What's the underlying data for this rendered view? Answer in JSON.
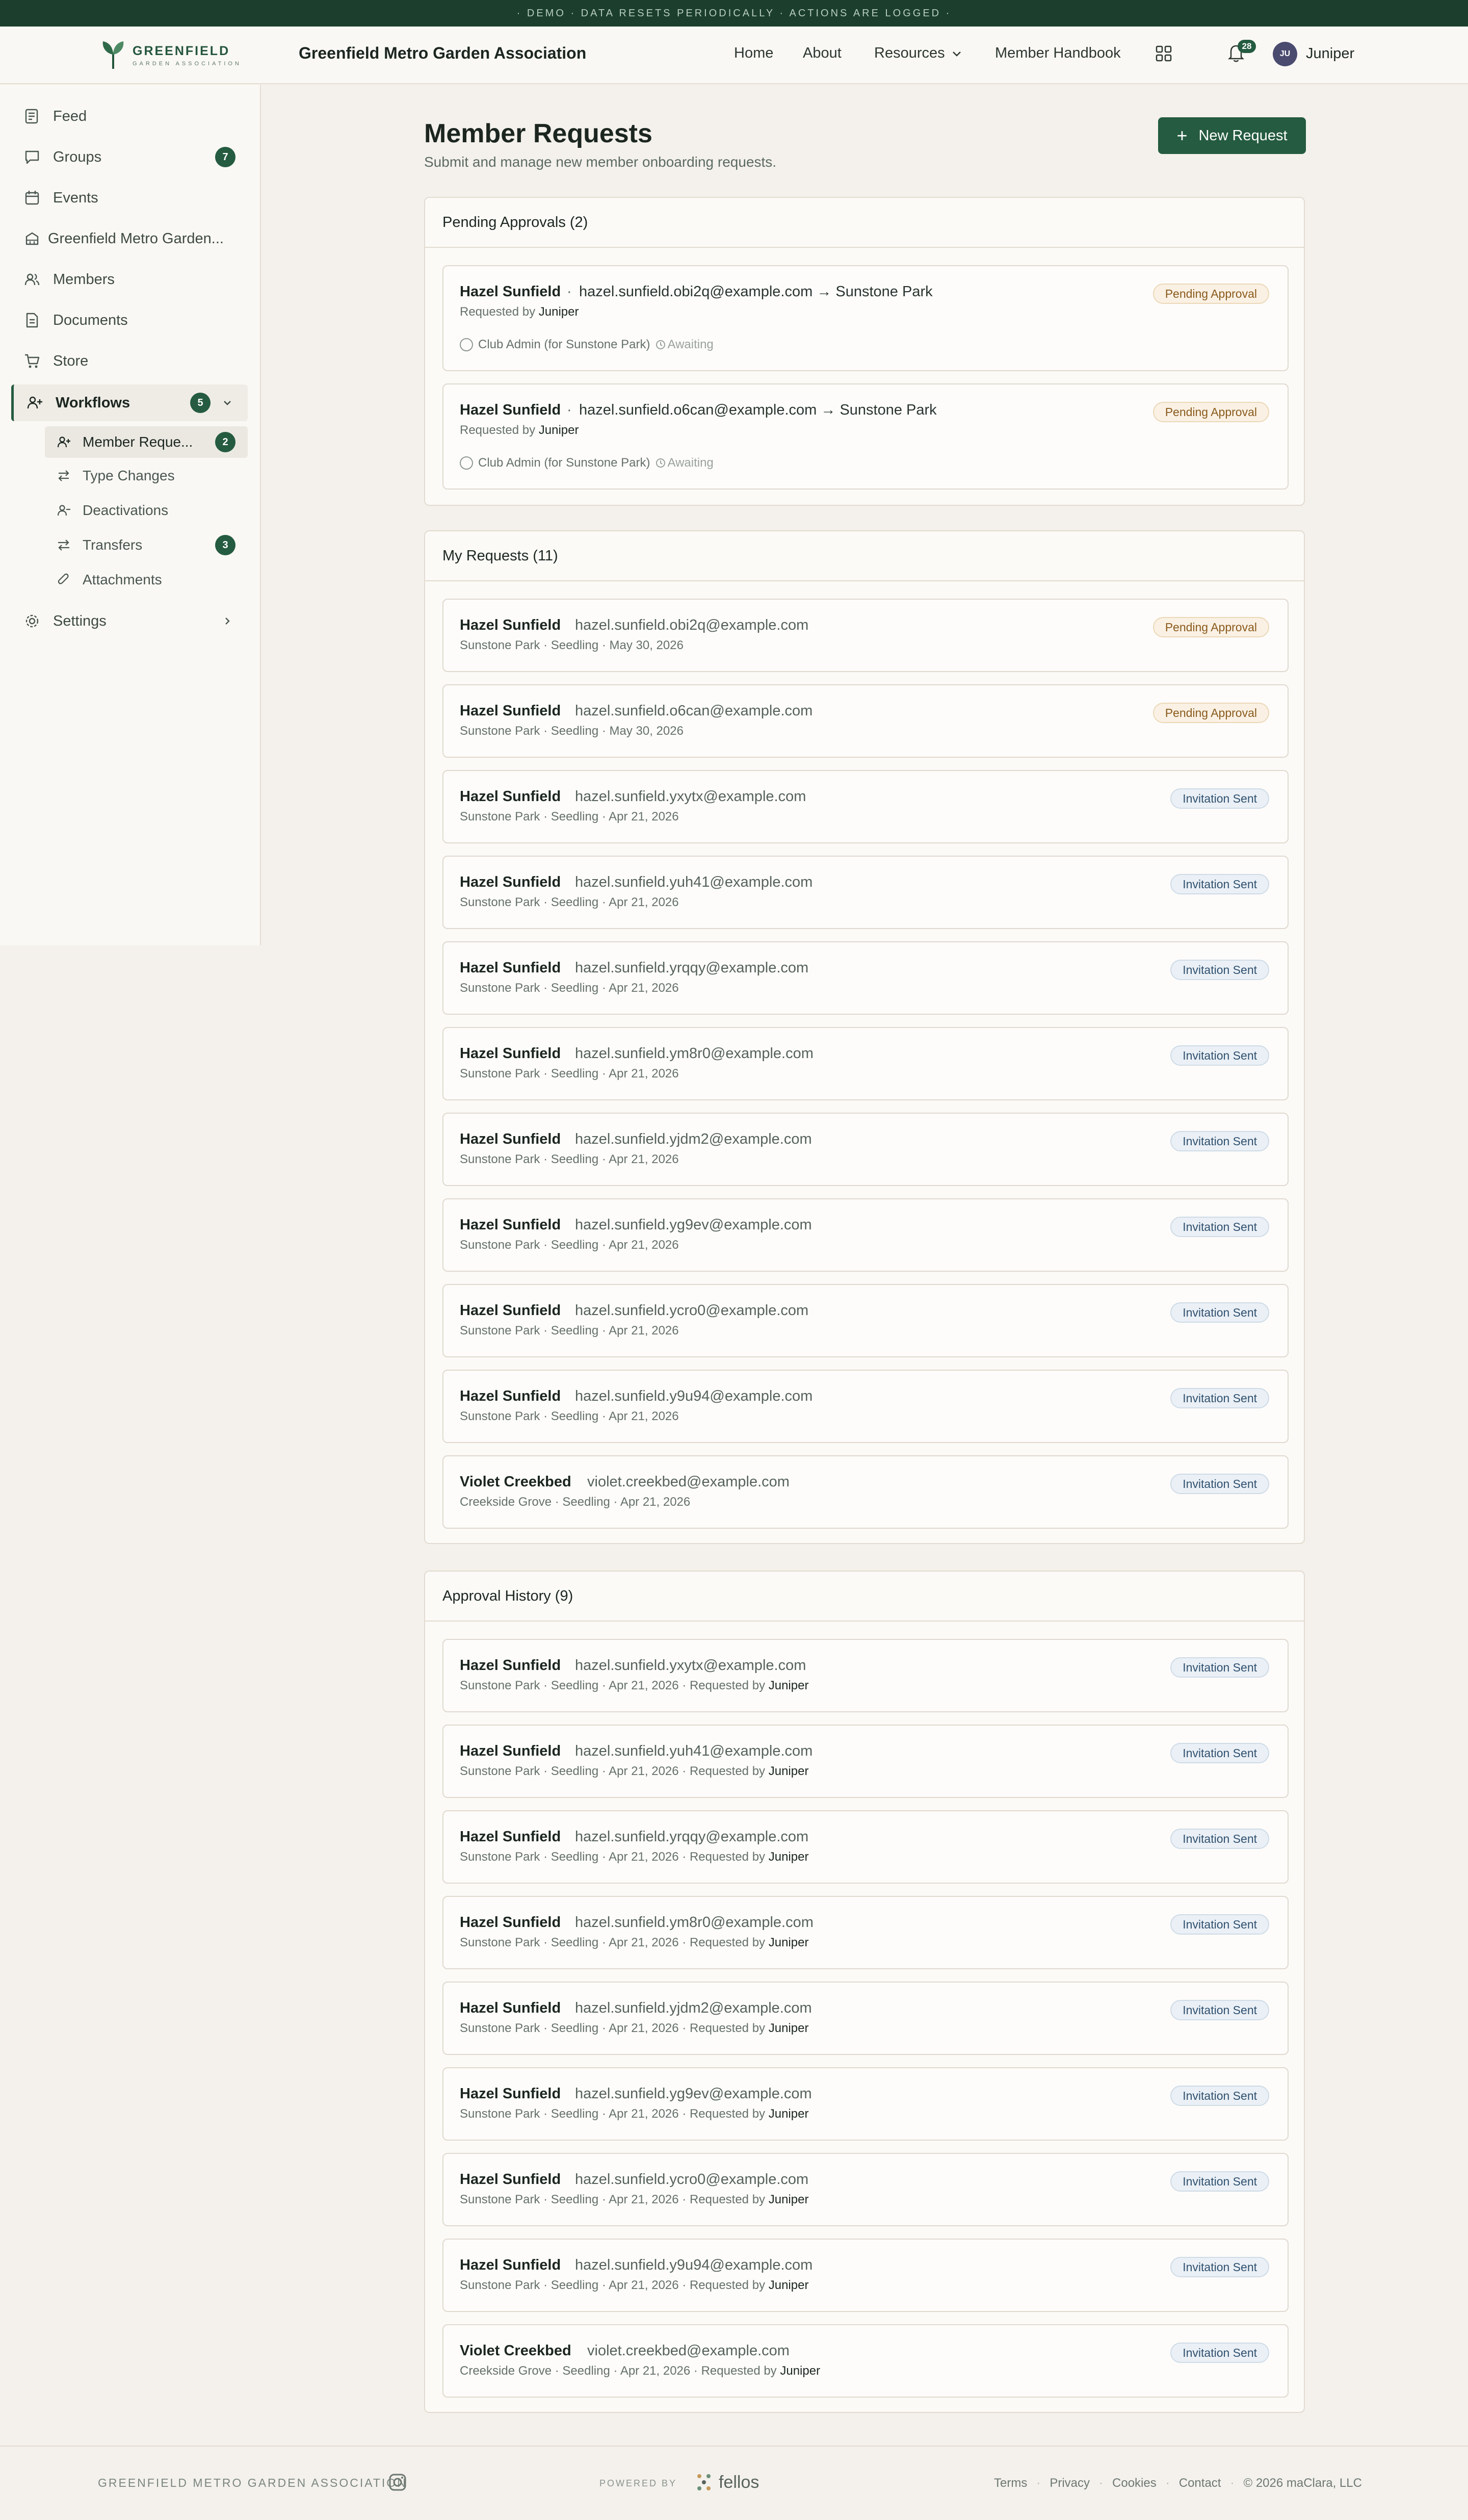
{
  "banner": "· DEMO · DATA RESETS PERIODICALLY · ACTIONS ARE LOGGED ·",
  "logo": {
    "line1": "GREENFIELD",
    "line2": "GARDEN ASSOCIATION"
  },
  "header": {
    "site_title": "Greenfield Metro Garden Association",
    "nav": {
      "home": "Home",
      "about": "About",
      "resources": "Resources",
      "handbook": "Member Handbook"
    },
    "notif_count": "28",
    "avatar_initials": "JU",
    "user": "Juniper"
  },
  "sidebar": {
    "items": [
      {
        "label": "Feed"
      },
      {
        "label": "Groups",
        "badge": "7"
      },
      {
        "label": "Events"
      },
      {
        "label": "Greenfield Metro Garden..."
      },
      {
        "label": "Members"
      },
      {
        "label": "Documents"
      },
      {
        "label": "Store"
      },
      {
        "label": "Workflows",
        "badge": "5"
      },
      {
        "label": "Settings"
      }
    ],
    "sub": [
      {
        "label": "Member Reque...",
        "badge": "2"
      },
      {
        "label": "Type Changes"
      },
      {
        "label": "Deactivations"
      },
      {
        "label": "Transfers",
        "badge": "3"
      },
      {
        "label": "Attachments"
      }
    ]
  },
  "page": {
    "title": "Member Requests",
    "subtitle": "Submit and manage new member onboarding requests.",
    "new_button": "New Request"
  },
  "pending": {
    "title": "Pending Approvals (2)",
    "items": [
      {
        "name": "Hazel Sunfield",
        "email": "hazel.sunfield.obi2q@example.com",
        "target": "Sunstone Park",
        "requested_prefix": "Requested by",
        "requested_by": "Juniper",
        "approver": "Club Admin (for Sunstone Park)",
        "awaiting": "Awaiting",
        "status": "Pending Approval"
      },
      {
        "name": "Hazel Sunfield",
        "email": "hazel.sunfield.o6can@example.com",
        "target": "Sunstone Park",
        "requested_prefix": "Requested by",
        "requested_by": "Juniper",
        "approver": "Club Admin (for Sunstone Park)",
        "awaiting": "Awaiting",
        "status": "Pending Approval"
      }
    ]
  },
  "my_requests": {
    "title": "My Requests (11)",
    "items": [
      {
        "name": "Hazel Sunfield",
        "email": "hazel.sunfield.obi2q@example.com",
        "meta": "Sunstone Park · Seedling · May 30, 2026",
        "status": "Pending Approval"
      },
      {
        "name": "Hazel Sunfield",
        "email": "hazel.sunfield.o6can@example.com",
        "meta": "Sunstone Park · Seedling · May 30, 2026",
        "status": "Pending Approval"
      },
      {
        "name": "Hazel Sunfield",
        "email": "hazel.sunfield.yxytx@example.com",
        "meta": "Sunstone Park · Seedling · Apr 21, 2026",
        "status": "Invitation Sent"
      },
      {
        "name": "Hazel Sunfield",
        "email": "hazel.sunfield.yuh41@example.com",
        "meta": "Sunstone Park · Seedling · Apr 21, 2026",
        "status": "Invitation Sent"
      },
      {
        "name": "Hazel Sunfield",
        "email": "hazel.sunfield.yrqqy@example.com",
        "meta": "Sunstone Park · Seedling · Apr 21, 2026",
        "status": "Invitation Sent"
      },
      {
        "name": "Hazel Sunfield",
        "email": "hazel.sunfield.ym8r0@example.com",
        "meta": "Sunstone Park · Seedling · Apr 21, 2026",
        "status": "Invitation Sent"
      },
      {
        "name": "Hazel Sunfield",
        "email": "hazel.sunfield.yjdm2@example.com",
        "meta": "Sunstone Park · Seedling · Apr 21, 2026",
        "status": "Invitation Sent"
      },
      {
        "name": "Hazel Sunfield",
        "email": "hazel.sunfield.yg9ev@example.com",
        "meta": "Sunstone Park · Seedling · Apr 21, 2026",
        "status": "Invitation Sent"
      },
      {
        "name": "Hazel Sunfield",
        "email": "hazel.sunfield.ycro0@example.com",
        "meta": "Sunstone Park · Seedling · Apr 21, 2026",
        "status": "Invitation Sent"
      },
      {
        "name": "Hazel Sunfield",
        "email": "hazel.sunfield.y9u94@example.com",
        "meta": "Sunstone Park · Seedling · Apr 21, 2026",
        "status": "Invitation Sent"
      },
      {
        "name": "Violet Creekbed",
        "email": "violet.creekbed@example.com",
        "meta": "Creekside Grove · Seedling · Apr 21, 2026",
        "status": "Invitation Sent"
      }
    ]
  },
  "history": {
    "title": "Approval History (9)",
    "requested_prefix": "· Requested by",
    "items": [
      {
        "name": "Hazel Sunfield",
        "email": "hazel.sunfield.yxytx@example.com",
        "meta": "Sunstone Park · Seedling · Apr 21, 2026",
        "requested_by": "Juniper",
        "status": "Invitation Sent"
      },
      {
        "name": "Hazel Sunfield",
        "email": "hazel.sunfield.yuh41@example.com",
        "meta": "Sunstone Park · Seedling · Apr 21, 2026",
        "requested_by": "Juniper",
        "status": "Invitation Sent"
      },
      {
        "name": "Hazel Sunfield",
        "email": "hazel.sunfield.yrqqy@example.com",
        "meta": "Sunstone Park · Seedling · Apr 21, 2026",
        "requested_by": "Juniper",
        "status": "Invitation Sent"
      },
      {
        "name": "Hazel Sunfield",
        "email": "hazel.sunfield.ym8r0@example.com",
        "meta": "Sunstone Park · Seedling · Apr 21, 2026",
        "requested_by": "Juniper",
        "status": "Invitation Sent"
      },
      {
        "name": "Hazel Sunfield",
        "email": "hazel.sunfield.yjdm2@example.com",
        "meta": "Sunstone Park · Seedling · Apr 21, 2026",
        "requested_by": "Juniper",
        "status": "Invitation Sent"
      },
      {
        "name": "Hazel Sunfield",
        "email": "hazel.sunfield.yg9ev@example.com",
        "meta": "Sunstone Park · Seedling · Apr 21, 2026",
        "requested_by": "Juniper",
        "status": "Invitation Sent"
      },
      {
        "name": "Hazel Sunfield",
        "email": "hazel.sunfield.ycro0@example.com",
        "meta": "Sunstone Park · Seedling · Apr 21, 2026",
        "requested_by": "Juniper",
        "status": "Invitation Sent"
      },
      {
        "name": "Hazel Sunfield",
        "email": "hazel.sunfield.y9u94@example.com",
        "meta": "Sunstone Park · Seedling · Apr 21, 2026",
        "requested_by": "Juniper",
        "status": "Invitation Sent"
      },
      {
        "name": "Violet Creekbed",
        "email": "violet.creekbed@example.com",
        "meta": "Creekside Grove · Seedling · Apr 21, 2026",
        "requested_by": "Juniper",
        "status": "Invitation Sent"
      }
    ]
  },
  "footer": {
    "org": "GREENFIELD METRO GARDEN ASSOCIATION",
    "powered": "POWERED BY",
    "brand": "fellos",
    "links": [
      "Terms",
      "Privacy",
      "Cookies",
      "Contact"
    ],
    "copyright": "© 2026 maClara, LLC"
  },
  "colors": {
    "brand": "#255b40",
    "banner": "#1b3f2c",
    "pending": "#8a5a1c",
    "sent": "#30506e"
  }
}
